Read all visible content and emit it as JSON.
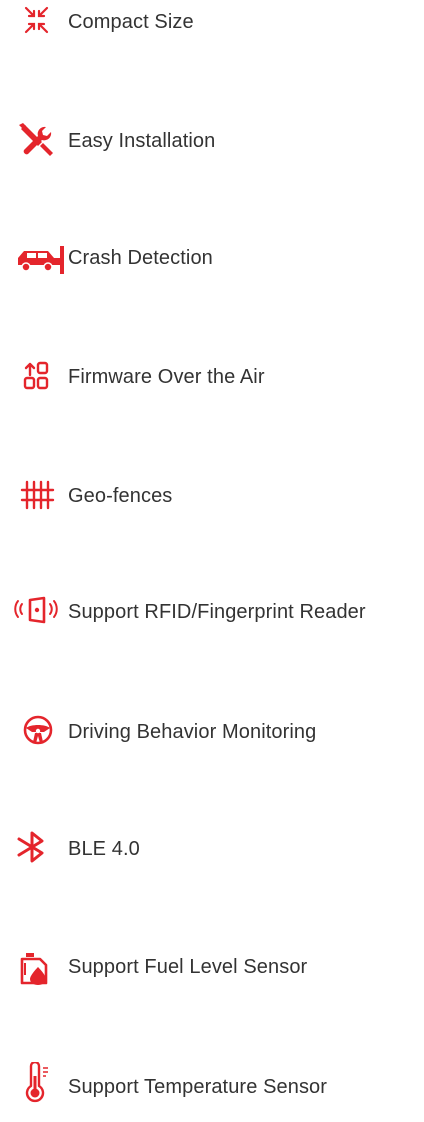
{
  "accent_color": "#e4252c",
  "features": [
    {
      "label": "Compact Size",
      "icon": "compact-size-icon"
    },
    {
      "label": "Easy Installation",
      "icon": "wrench-screwdriver-icon"
    },
    {
      "label": "Crash Detection",
      "icon": "car-crash-icon"
    },
    {
      "label": "Firmware Over the Air",
      "icon": "firmware-update-icon"
    },
    {
      "label": "Geo-fences",
      "icon": "geofence-icon"
    },
    {
      "label": "Support RFID/Fingerprint Reader",
      "icon": "rfid-reader-icon"
    },
    {
      "label": "Driving Behavior Monitoring",
      "icon": "steering-wheel-icon"
    },
    {
      "label": "BLE 4.0",
      "icon": "bluetooth-icon"
    },
    {
      "label": "Support Fuel Level Sensor",
      "icon": "fuel-can-icon"
    },
    {
      "label": "Support Temperature Sensor",
      "icon": "thermometer-icon"
    }
  ]
}
